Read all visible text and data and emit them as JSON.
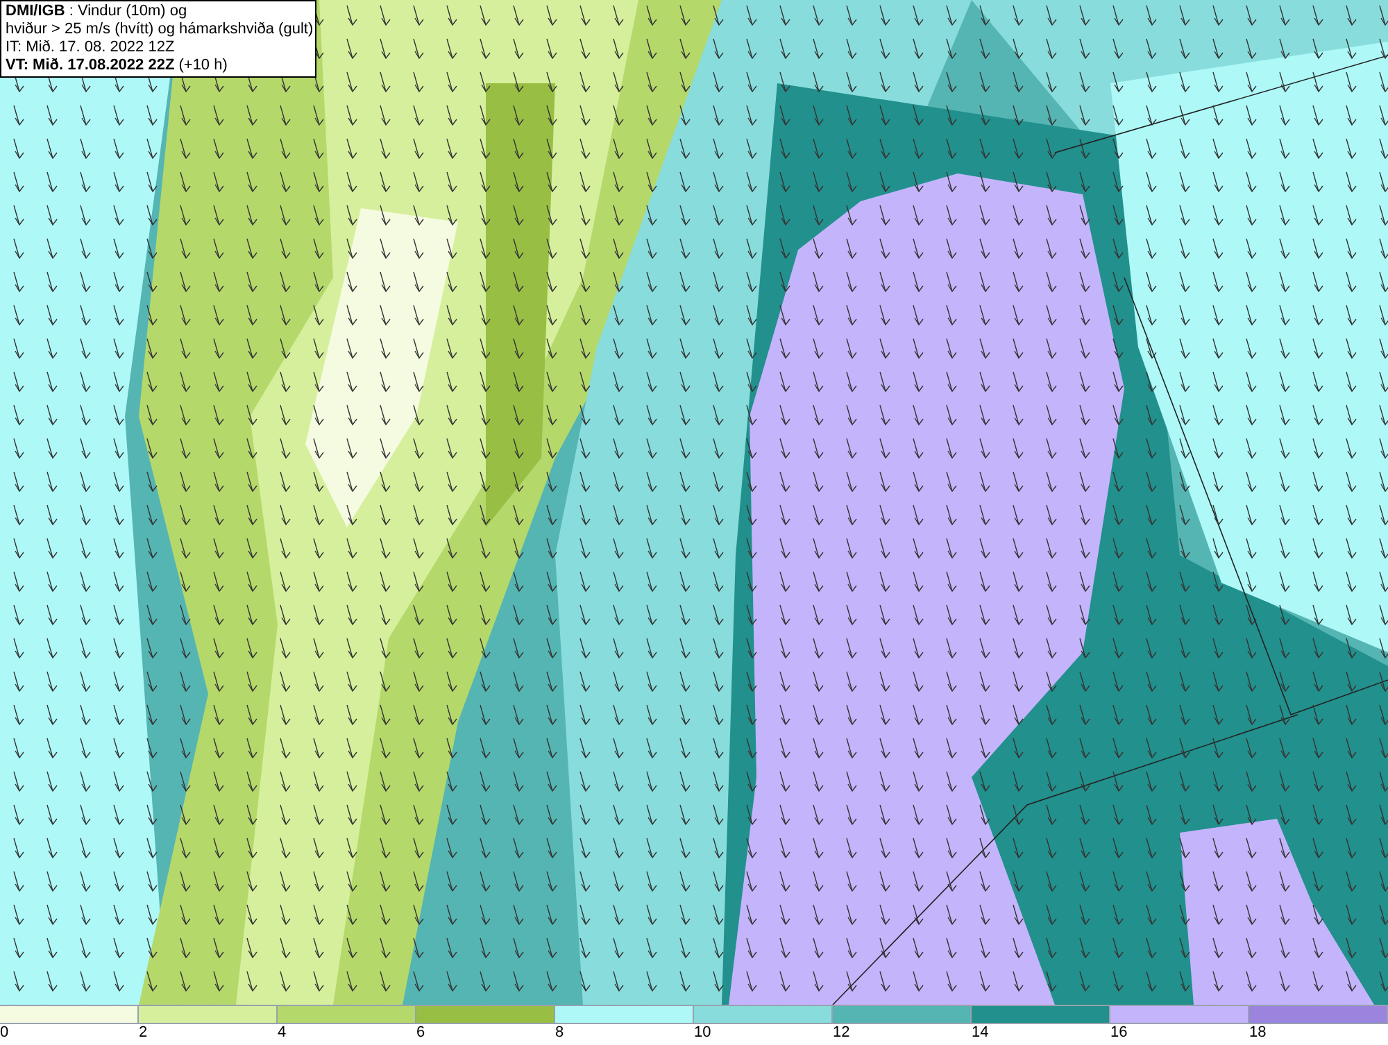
{
  "info_box": {
    "lines": [
      "**DMI/IGB** : Vindur (10m) og",
      "hviður > 25 m/s (hvítt) og hámarkshviða (gult)",
      "IT: Mið. 17. 08. 2022 12Z",
      "**VT: Mið. 17.08.2022 22Z** (+10 h)"
    ]
  },
  "legend": {
    "swatches": [
      {
        "color": "#f4fbe0"
      },
      {
        "color": "#d6ef9c"
      },
      {
        "color": "#b5d86b"
      },
      {
        "color": "#98bf44"
      },
      {
        "color": "#aef8f8"
      },
      {
        "color": "#88dcdc"
      },
      {
        "color": "#55b5b3"
      },
      {
        "color": "#22908c"
      },
      {
        "color": "#c4b4fb"
      },
      {
        "color": "#9a84de"
      }
    ],
    "labels": [
      "0",
      "2",
      "4",
      "6",
      "8",
      "10",
      "12",
      "14",
      "16",
      "18"
    ]
  }
}
